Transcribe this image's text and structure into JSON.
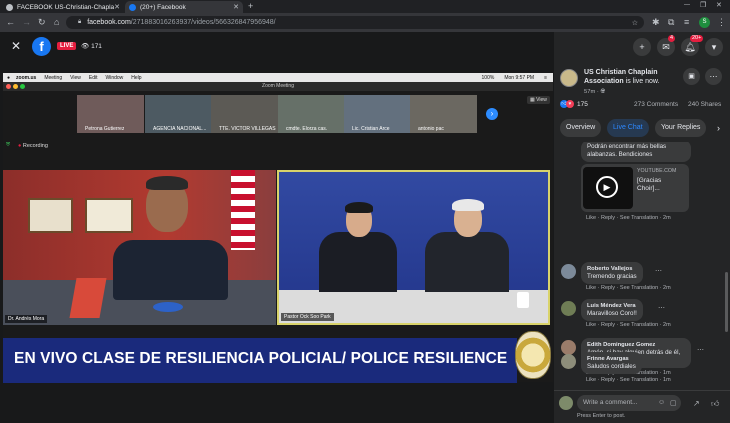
{
  "browser": {
    "tabs": [
      {
        "title": "FACEBOOK US-Christian-Chapla"
      },
      {
        "title": "(20+) Facebook"
      }
    ],
    "new_tab": "+",
    "url_host": "facebook.com",
    "url_path": "/271883016263937/videos/566326847956948/",
    "profile_initial": "S"
  },
  "viewer": {
    "live_label": "LIVE",
    "viewers": "171",
    "close": "✕"
  },
  "zoom": {
    "app": "zoom.us",
    "menu": [
      "Meeting",
      "View",
      "Edit",
      "Window",
      "Help"
    ],
    "battery": "100%",
    "clock": "Mon 9:57 PM",
    "window_title": "Zoom Meeting",
    "view_label": "View",
    "recording": "Recording",
    "participants": [
      {
        "name": "Petrona Gutierrez"
      },
      {
        "name": "AGENCIA NACIONAL..."
      },
      {
        "name": "TTE. VICTOR VILLEGAS"
      },
      {
        "name": "cmdte. Elorza cas."
      },
      {
        "name": "Lic. Cristian Arce"
      },
      {
        "name": "antonio pac"
      }
    ],
    "speaker_left": "Dr. Andrés Mora",
    "speaker_right": "Pastor Ock Soo Park",
    "banner": "EN VIVO CLASE DE RESILIENCIA POLICIAL/ POLICE RESILIENCE"
  },
  "page": {
    "name": "US Christian Chaplain Association",
    "status": "is live now.",
    "time": "57m",
    "reactions": "175",
    "comments_count": "273 Comments",
    "shares_count": "240 Shares",
    "tabs": [
      "Overview",
      "Live Chat",
      "Your Replies"
    ],
    "notif_badge_1": "4",
    "notif_badge_2": "20+"
  },
  "chat": [
    {
      "name": "",
      "text": "Podrán encontrar más bellas alabanzas. Bendiciones",
      "link_source": "YOUTUBE.COM",
      "link_title": "[Gracias Choir]...",
      "actions": "Like · Reply · See Translation · 2m"
    },
    {
      "name": "Roberto Vallejos",
      "text": "Tremendo gracias",
      "actions": "Like · Reply · See Translation · 2m"
    },
    {
      "name": "Luis Méndez Vera",
      "text": "Maravilloso Coro!!",
      "actions": "Like · Reply · See Translation · 2m"
    },
    {
      "name": "Edith Dominguez Gomez",
      "text": "Amén, si hay alguien detrás de él, Dios mismo",
      "actions": "Like · Reply · See Translation · 1m"
    },
    {
      "name": "Frinne Avargas",
      "text": "Saludos cordiales",
      "actions": "Like · Reply · See Translation · 1m"
    }
  ],
  "composer": {
    "placeholder": "Write a comment...",
    "hint": "Press Enter to post."
  },
  "colors": {
    "facebook_blue": "#1877f2",
    "live_red": "#e41e3f",
    "banner_blue": "#1a2a7c"
  }
}
